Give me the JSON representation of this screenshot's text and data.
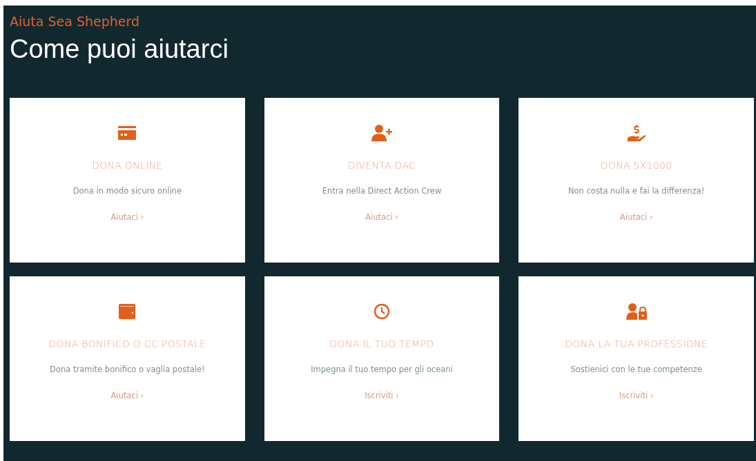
{
  "header": {
    "kicker": "Aiuta Sea Shepherd",
    "title": "Come puoi aiutarci"
  },
  "cards": [
    {
      "title": "DONA ONLINE",
      "text": "Dona in modo sicuro online",
      "link": "Aiutaci ›"
    },
    {
      "title": "DIVENTA DAC",
      "text": "Entra nella Direct Action Crew",
      "link": "Aiutaci ›"
    },
    {
      "title": "DONA 5X1000",
      "text": "Non costa nulla e fai la differenza!",
      "link": "Aiutaci ›"
    },
    {
      "title": "DONA BONIFICO O CC POSTALE",
      "text": "Dona tramite bonifico o vaglia postale!",
      "link": "Aiutaci ›"
    },
    {
      "title": "DONA IL TUO TEMPO",
      "text": "Impegna il tuo tempo per gli oceani",
      "link": "Iscriviti ›"
    },
    {
      "title": "DONA LA TUA PROFESSIONE",
      "text": "Sostienici con le tue competenze",
      "link": "Iscriviti ›"
    }
  ]
}
